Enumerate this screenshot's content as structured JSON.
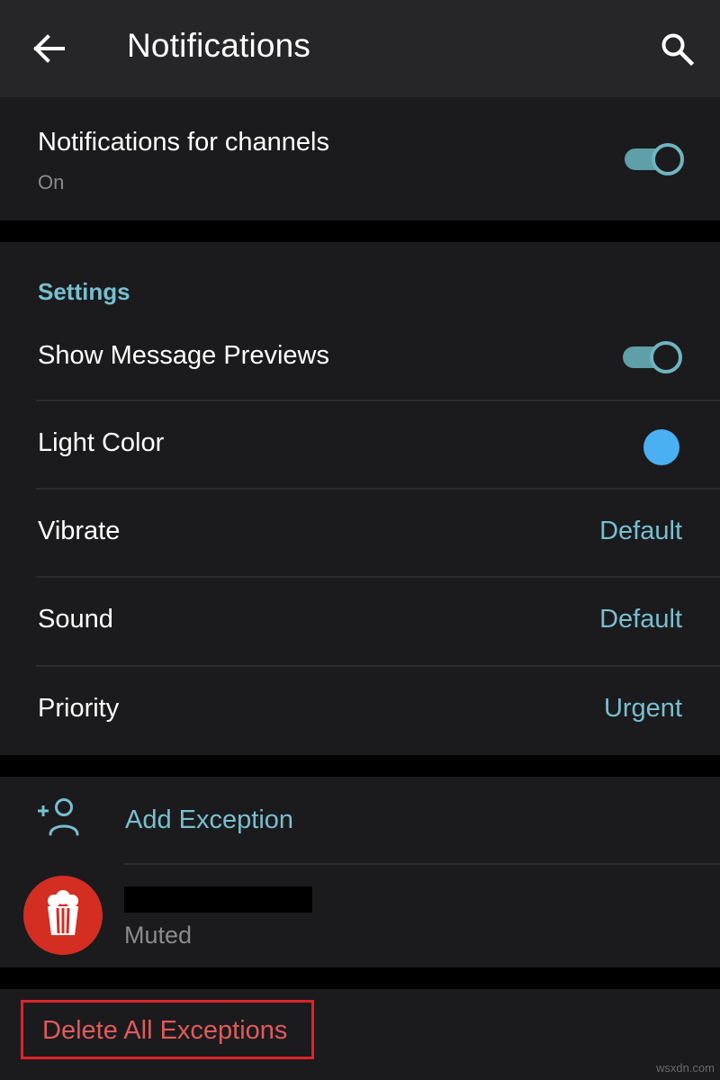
{
  "appbar": {
    "title": "Notifications",
    "back_icon": "arrow-left-icon",
    "search_icon": "search-icon"
  },
  "channels": {
    "title": "Notifications for channels",
    "status": "On",
    "toggle_on": true
  },
  "settings": {
    "header": "Settings",
    "rows": [
      {
        "label": "Show Message Previews",
        "type": "toggle",
        "on": true
      },
      {
        "label": "Light Color",
        "type": "color",
        "color": "#4ab0f1"
      },
      {
        "label": "Vibrate",
        "type": "value",
        "value": "Default"
      },
      {
        "label": "Sound",
        "type": "value",
        "value": "Default"
      },
      {
        "label": "Priority",
        "type": "value",
        "value": "Urgent"
      }
    ]
  },
  "exceptions": {
    "add_label": "Add Exception",
    "add_icon": "add-user-icon",
    "items": [
      {
        "name_redacted": true,
        "status": "Muted",
        "avatar_icon": "popcorn-icon",
        "avatar_color": "#d42e23"
      }
    ]
  },
  "footer": {
    "delete_label": "Delete All Exceptions"
  },
  "watermark": "wsxdn.com",
  "colors": {
    "accent": "#78bfd0",
    "danger": "#e05a5d",
    "highlight_box": "#e1222a",
    "background": "#1b1b1d",
    "appbar": "#262629"
  }
}
